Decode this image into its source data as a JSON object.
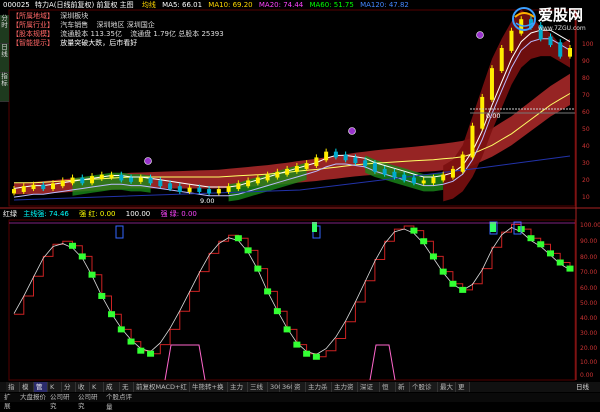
{
  "header": {
    "code": "000025",
    "name": "特力A(日线前复权) 前复权 主图",
    "ma": "均线",
    "ma_items": [
      {
        "label": "MA5: 66.01",
        "color": "#ffffff"
      },
      {
        "label": "MA10: 69.20",
        "color": "#ffd700"
      },
      {
        "label": "MA20: 74.44",
        "color": "#ff44ff"
      },
      {
        "label": "MA60: 51.75",
        "color": "#00ff00"
      },
      {
        "label": "MA120: 47.82",
        "color": "#4488ff"
      }
    ]
  },
  "info_panel": {
    "rows": [
      {
        "tag": "【所属地域】",
        "value": "深圳板块",
        "extra": ""
      },
      {
        "tag": "【所属行业】",
        "value": "汽车销售",
        "extra": "深圳地区 深圳国企"
      },
      {
        "tag": "【股本规模】",
        "value": "流通股本 113.35亿",
        "extra": "流通盘 1.79亿 总股本 25393"
      },
      {
        "tag": "【智能提示】",
        "value": "放量突破大跌，后市看好",
        "extra": ""
      }
    ]
  },
  "watermark": {
    "brand": "爱股网",
    "url": "www.7ZGU.com"
  },
  "main_price_labels": [
    "100",
    "90",
    "80",
    "70",
    "60",
    "50",
    "40",
    "30",
    "20",
    "10"
  ],
  "annotations": [
    {
      "text": "0.00"
    },
    {
      "text": "9.00"
    }
  ],
  "sub_header": {
    "title": "红绿",
    "items": [
      {
        "label": "主线强: 74.46",
        "color": "#00ffff"
      },
      {
        "label": "强 红: 0.00",
        "color": "#ffff00"
      },
      {
        "label": "100.00",
        "color": "#ffffff"
      },
      {
        "label": "强 绿: 0.00",
        "color": "#ff44ff"
      }
    ]
  },
  "sub_labels": [
    "100.00",
    "90.00",
    "80.00",
    "70.00",
    "60.00",
    "50.00",
    "40.00",
    "30.00",
    "20.00",
    "10.00",
    "0.00"
  ],
  "side_tabs": [
    "分时",
    "日线",
    "指标"
  ],
  "toolbar": {
    "items": [
      "指标",
      "模板",
      "管理",
      "K线",
      "分时",
      "收盘",
      "K线",
      "成交量",
      "无线",
      "前复权MACD+红绿灯",
      "牛熊转+换手率",
      "主力趋势",
      "三线粘合",
      "300",
      "360",
      "资金",
      "主力杀跌",
      "主力资金",
      "深证成",
      "恒生",
      "新闻",
      "个股诊断",
      "最大盘",
      "更多"
    ],
    "active_index": 2,
    "right_label": "日线"
  },
  "bottom_bar": {
    "items": [
      "扩展",
      "大盘报价",
      "公司研究",
      "公司研究",
      "个股点评"
    ]
  },
  "chart_data": [
    {
      "type": "candlestick",
      "title": "特力A 日线前复权",
      "n": 58,
      "close": [
        13,
        14,
        14.5,
        14,
        15,
        16,
        17,
        16,
        17.5,
        18,
        18,
        17,
        16.5,
        17,
        16,
        15,
        14,
        13,
        13.5,
        13,
        12.5,
        13,
        14,
        15,
        16,
        17,
        18,
        19,
        20,
        21,
        22,
        24,
        26,
        25,
        24,
        23,
        22,
        20,
        19,
        18,
        17,
        16,
        16,
        17,
        18,
        20,
        25,
        35,
        45,
        55,
        62,
        68,
        72,
        70,
        66,
        64,
        60,
        62
      ],
      "ma5": [
        13,
        13.5,
        14,
        14,
        14.5,
        15,
        15.5,
        16,
        16.5,
        17,
        17.5,
        17.5,
        17,
        17,
        16.5,
        16,
        15.5,
        15,
        14.5,
        14,
        13.5,
        13.5,
        13.5,
        14,
        15,
        16,
        17,
        18,
        19,
        20,
        21,
        22,
        23.5,
        24.5,
        24.5,
        24,
        23.5,
        22,
        21,
        20,
        19,
        18,
        17,
        17,
        17.5,
        18.5,
        21,
        26,
        33,
        42,
        50,
        58,
        64,
        67,
        68,
        68,
        66,
        64
      ],
      "ma60": [
        13,
        13,
        13,
        13.2,
        13.4,
        13.6,
        13.8,
        14,
        14.2,
        14.4,
        14.6,
        14.8,
        15,
        15,
        15,
        15,
        15,
        15,
        15,
        15,
        15,
        15,
        15.2,
        15.4,
        15.6,
        15.8,
        16,
        16.3,
        16.6,
        17,
        17.3,
        17.6,
        18,
        18.4,
        18.8,
        19.2,
        19.5,
        19.8,
        20,
        20.2,
        20.4,
        20.6,
        20.8,
        21,
        21.3,
        21.6,
        22,
        23,
        24.5,
        26,
        28,
        30,
        32.5,
        35,
        37.5,
        40,
        42,
        44
      ]
    },
    {
      "type": "step",
      "title": "红绿",
      "ylim": [
        0,
        100
      ],
      "values": [
        40,
        52,
        65,
        78,
        86,
        88,
        85,
        78,
        66,
        52,
        40,
        30,
        22,
        16,
        14,
        20,
        30,
        42,
        55,
        68,
        80,
        88,
        92,
        90,
        82,
        70,
        55,
        42,
        30,
        20,
        14,
        12,
        16,
        24,
        35,
        48,
        62,
        76,
        88,
        96,
        98,
        95,
        88,
        78,
        68,
        60,
        56,
        60,
        70,
        84,
        94,
        99,
        96,
        90,
        86,
        80,
        74,
        70
      ]
    }
  ]
}
